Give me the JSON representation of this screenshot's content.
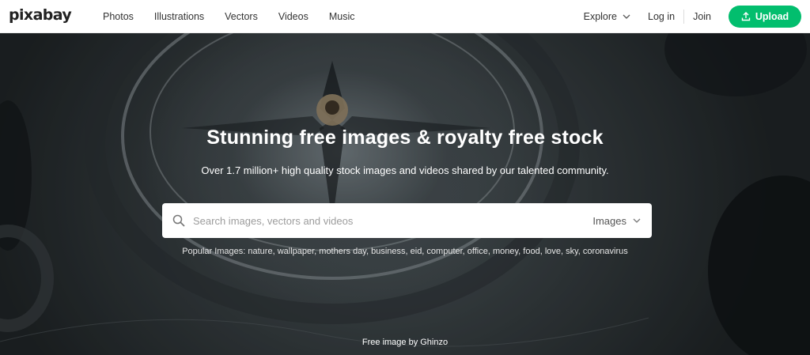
{
  "header": {
    "logo": "pixabay",
    "nav": [
      "Photos",
      "Illustrations",
      "Vectors",
      "Videos",
      "Music"
    ],
    "explore_label": "Explore",
    "login_label": "Log in",
    "join_label": "Join",
    "upload_label": "Upload",
    "accent_color": "#02be6e"
  },
  "hero": {
    "headline": "Stunning free images & royalty free stock",
    "subline": "Over 1.7 million+ high quality stock images and videos shared by our talented community.",
    "search": {
      "placeholder": "Search images, vectors and videos",
      "value": "",
      "type_selected": "Images"
    },
    "popular_label": "Popular Images:",
    "popular_terms": "nature, wallpaper, mothers day, business, eid, computer, office, money, food, love, sky, coronavirus",
    "credit": "Free image by Ghinzo"
  },
  "icons": {
    "search": "search-icon",
    "upload": "upload-icon",
    "chevron": "chevron-down-icon"
  }
}
